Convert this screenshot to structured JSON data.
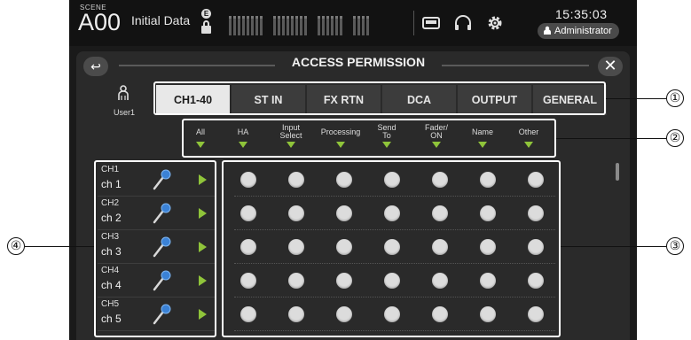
{
  "topbar": {
    "scene_label": "SCENE",
    "scene_number": "A00",
    "scene_name": "Initial Data",
    "lock_badge": "E",
    "clock": "15:35:03",
    "user_role": "Administrator",
    "icons": [
      "lock-icon",
      "meter-icon",
      "recorder-icon",
      "headphones-icon",
      "gear-icon",
      "user-icon"
    ]
  },
  "dialog": {
    "title": "ACCESS PERMISSION",
    "back_glyph": "↩",
    "close_glyph": "✕",
    "user_name": "User1",
    "tabs": [
      {
        "label": "CH1-40",
        "active": true
      },
      {
        "label": "ST IN",
        "active": false
      },
      {
        "label": "FX RTN",
        "active": false
      },
      {
        "label": "DCA",
        "active": false
      },
      {
        "label": "OUTPUT",
        "active": false
      },
      {
        "label": "GENERAL",
        "active": false
      }
    ],
    "categories": [
      {
        "line1": "All",
        "line2": ""
      },
      {
        "line1": "HA",
        "line2": ""
      },
      {
        "line1": "Input",
        "line2": "Select"
      },
      {
        "line1": "Processing",
        "line2": ""
      },
      {
        "line1": "Send",
        "line2": "To"
      },
      {
        "line1": "Fader/",
        "line2": "ON"
      },
      {
        "line1": "Name",
        "line2": ""
      },
      {
        "line1": "Other",
        "line2": ""
      }
    ],
    "channels": [
      {
        "number": "CH1",
        "name": "ch 1"
      },
      {
        "number": "CH2",
        "name": "ch 2"
      },
      {
        "number": "CH3",
        "name": "ch 3"
      },
      {
        "number": "CH4",
        "name": "ch 4"
      },
      {
        "number": "CH5",
        "name": "ch 5"
      }
    ],
    "permission_columns": 7
  },
  "callouts": [
    "①",
    "②",
    "③",
    "④"
  ],
  "colors": {
    "accent_green": "#8fc43a",
    "tab_active": "#e8e8e8",
    "permission_dot": "#dcdcdc"
  }
}
